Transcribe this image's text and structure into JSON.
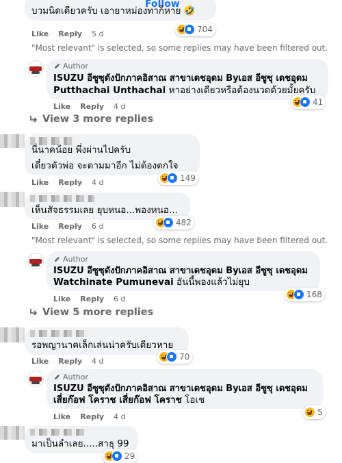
{
  "follow": "Follow",
  "actions": {
    "like": "Like",
    "reply": "Reply"
  },
  "notice": "\"Most relevant\" is selected, so some replies may have been filtered out.",
  "author_badge": "Author",
  "page_name": "ISUZU อีซูซุดังปักภาคอิสาณ สาขาเดชอุดม Byเอส อีซูซุ เดชอุดม",
  "comments": [
    {
      "text": "บวมนิดเดียวครับ เอายาหม่องทาก็หาย 🤣",
      "time": "5 d",
      "reactions": "704"
    },
    {
      "text": "หาอย่างเดียวหรือต้องนวดด้วยมั้ยครับ",
      "mention": "Putthachai Unthachai",
      "time": "4 d",
      "reactions": "41"
    },
    {
      "text_line1": "นี่นาคน้อย พึ่งผ่านไปครับ",
      "text_line2": "เดี๋ยวตัวพ่อ จะตามมาอีก ไม่ต้องตกใจ",
      "time": "4 d",
      "reactions": "149"
    },
    {
      "text": "เห็นสัจธรรมเลย ยุบหนอ...พองหนอ...",
      "time": "6 d",
      "reactions": "482"
    },
    {
      "text": "อันนี้พองแล้วไม่ยุบ",
      "mention": "Watchinate Pumunevai",
      "time": "6 d",
      "reactions": "168"
    },
    {
      "text": "รอพญานาคเล็กเล่นน่าครับเดียวหาย",
      "time": "4 d",
      "reactions": "70"
    },
    {
      "text": "โอเช",
      "mention": "เสี่ยก๊อฟ โคราช เสี่ยก๊อฟ โคราช",
      "time": "4 d",
      "reactions": "5"
    },
    {
      "text": "มาเป็นลำเลย.....สาธุ 99",
      "reactions": "29"
    }
  ],
  "view_more_1": "View 3 more replies",
  "view_more_2": "View 5 more replies",
  "colors": {
    "bubble": "#f0f2f5",
    "meta": "#65676b",
    "link": "#1877f2",
    "text": "#050505"
  }
}
